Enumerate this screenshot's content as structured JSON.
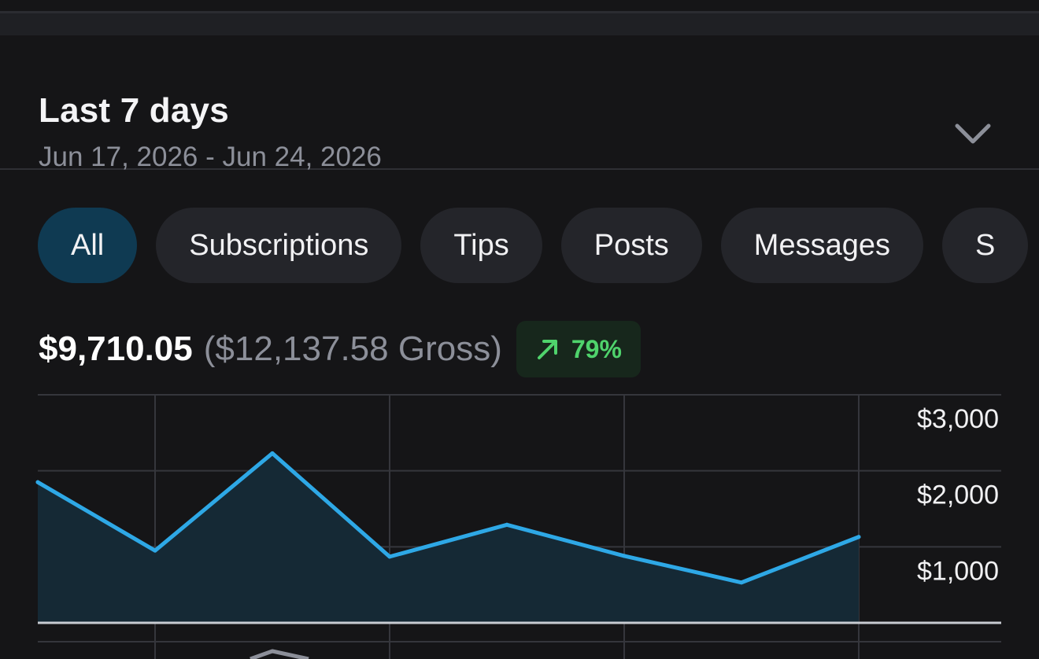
{
  "period": {
    "title": "Last 7 days",
    "range": "Jun 17, 2026 - Jun 24, 2026",
    "toggle_icon": "chevron-down-icon"
  },
  "filters": [
    {
      "label": "All",
      "active": true
    },
    {
      "label": "Subscriptions",
      "active": false
    },
    {
      "label": "Tips",
      "active": false
    },
    {
      "label": "Posts",
      "active": false
    },
    {
      "label": "Messages",
      "active": false
    },
    {
      "label": "S",
      "active": false
    }
  ],
  "summary": {
    "net": "$9,710.05",
    "gross": "($12,137.58 Gross)",
    "change": "79%",
    "change_icon": "arrow-up-right-icon"
  },
  "colors": {
    "accent": "#2ea8e6",
    "active_chip": "#0f3a52",
    "positive": "#4fd36c",
    "positive_bg": "#17271c"
  },
  "chart_data": {
    "type": "area",
    "x": [
      0,
      1,
      2,
      3,
      4,
      5,
      6,
      7
    ],
    "series": [
      {
        "values": [
          1850,
          950,
          2230,
          870,
          1290,
          880,
          530,
          1130
        ]
      }
    ],
    "y_ticks": [
      "$3,000",
      "$2,000",
      "$1,000"
    ],
    "ylim": [
      0,
      3000
    ],
    "grid": true,
    "y_axis_position": "right"
  }
}
